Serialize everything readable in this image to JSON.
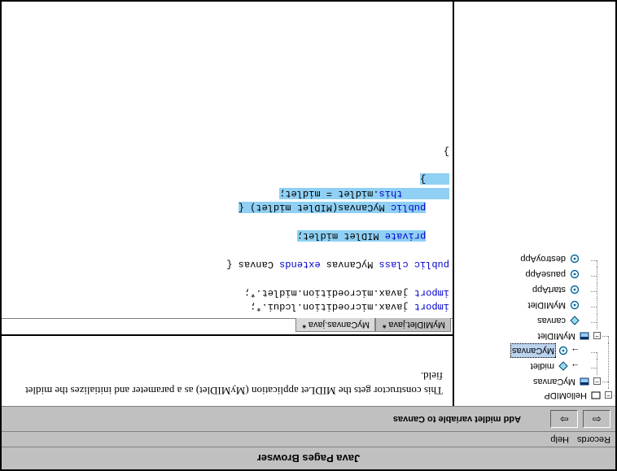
{
  "window": {
    "title": "Java Pages Browser"
  },
  "menu": {
    "records": "Records",
    "help": "Help"
  },
  "toolbar": {
    "back_glyph": "⇦",
    "forward_glyph": "⇨",
    "title": "Add midlet variable to Canvas"
  },
  "tree": {
    "root": "HelloMIDP",
    "mycanvas": "MyCanvas",
    "midlet_field": "midlet",
    "mycanvas_ctor": "MyCanvas",
    "mymidlet": "MyMIDlet",
    "canvas_field": "canvas",
    "mymidlet_ctor": "MyMIDlet",
    "startApp": "startApp",
    "pauseApp": "pauseApp",
    "destroyApp": "destroyApp"
  },
  "description": {
    "text": "This constructor gets the MIDLet application (MyMIDlet) as a parameter and initializes the midlet field."
  },
  "tabs": {
    "t0": {
      "label": "MyMIDlet.java",
      "modified": "*"
    },
    "t1": {
      "label": "MyCanvas.java",
      "modified": "*"
    }
  },
  "code": {
    "l1_a": "import",
    "l1_b": " javax.microedition.lcdui.*;",
    "l2_a": "import",
    "l2_b": " javax.microedition.midlet.*;",
    "blank": " ",
    "l4_a": "public class",
    "l4_b": " MyCanvas ",
    "l4_c": "extends",
    "l4_d": " Canvas {",
    "l6_pad": "    ",
    "l6_a": "private",
    "l6_b": " MIDlet midlet;",
    "l8_pad": "    ",
    "l8_a": "public",
    "l8_b": " MyCanvas(MIDlet midlet) {",
    "l9_pad": "        ",
    "l9_a": "this",
    "l9_b": ".midlet = midlet;",
    "l10_pad": "    ",
    "l10_a": "}",
    "l12": "}"
  }
}
